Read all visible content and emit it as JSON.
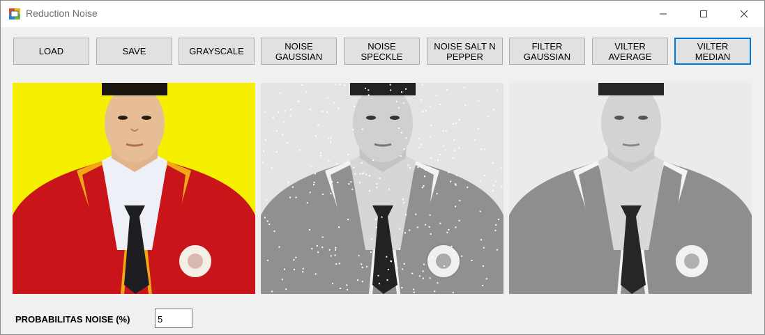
{
  "window": {
    "title": "Reduction Noise",
    "icon": "windows-form-icon",
    "controls": [
      "minimize-icon",
      "maximize-icon",
      "close-icon"
    ]
  },
  "toolbar": {
    "buttons": [
      {
        "label": "LOAD"
      },
      {
        "label": "SAVE"
      },
      {
        "label": "GRAYSCALE"
      },
      {
        "label": "NOISE\nGAUSSIAN"
      },
      {
        "label": "NOISE\nSPECKLE"
      },
      {
        "label": "NOISE SALT N\nPEPPER"
      },
      {
        "label": "FILTER\nGAUSSIAN"
      },
      {
        "label": "VILTER\nAVERAGE"
      },
      {
        "label": "VILTER\nMEDIAN",
        "focused": true
      }
    ]
  },
  "pictures": [
    {
      "content": "original color portrait"
    },
    {
      "content": "grayscale with salt and pepper noise"
    },
    {
      "content": "median filtered grayscale"
    }
  ],
  "noise": {
    "label": "PROBABILITAS NOISE (%)",
    "value": "5"
  },
  "colors": {
    "accent": "#0078d7",
    "background": "#f0f0f0",
    "button": "#e1e1e1"
  }
}
